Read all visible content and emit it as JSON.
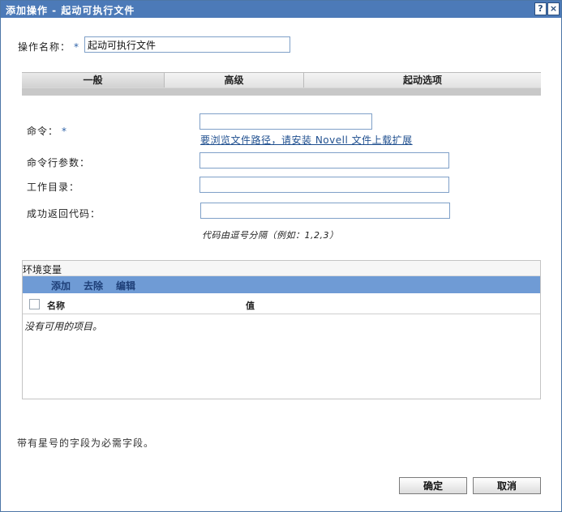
{
  "dialog": {
    "title": "添加操作 - 起动可执行文件",
    "help_label": "?",
    "close_label": "×"
  },
  "form": {
    "action_name_label": "操作名称：",
    "required_mark": "*",
    "action_name_value": "起动可执行文件"
  },
  "tabs": [
    {
      "label": "一般",
      "active": true
    },
    {
      "label": "高级",
      "active": false
    },
    {
      "label": "起动选项",
      "active": false
    }
  ],
  "general": {
    "command_label": "命令：",
    "command_value": "",
    "browse_link": "要浏览文件路径，请安装 Novell 文件上载扩展",
    "args_label": "命令行参数：",
    "args_value": "",
    "workdir_label": "工作目录：",
    "workdir_value": "",
    "success_codes_label": "成功返回代码：",
    "success_codes_value": "",
    "success_codes_hint": "代码由逗号分隔（例如：1,2,3）"
  },
  "env": {
    "title": "环境变量",
    "actions": {
      "add": "添加",
      "remove": "去除",
      "edit": "编辑"
    },
    "columns": {
      "name": "名称",
      "value": "值"
    },
    "empty_text": "没有可用的项目。",
    "rows": []
  },
  "footer": {
    "required_note": "带有星号的字段为必需字段。",
    "ok_label": "确定",
    "cancel_label": "取消"
  },
  "colors": {
    "titlebar": "#4c7ab8",
    "toolbar": "#6f9bd5",
    "required": "#2f63a8"
  }
}
